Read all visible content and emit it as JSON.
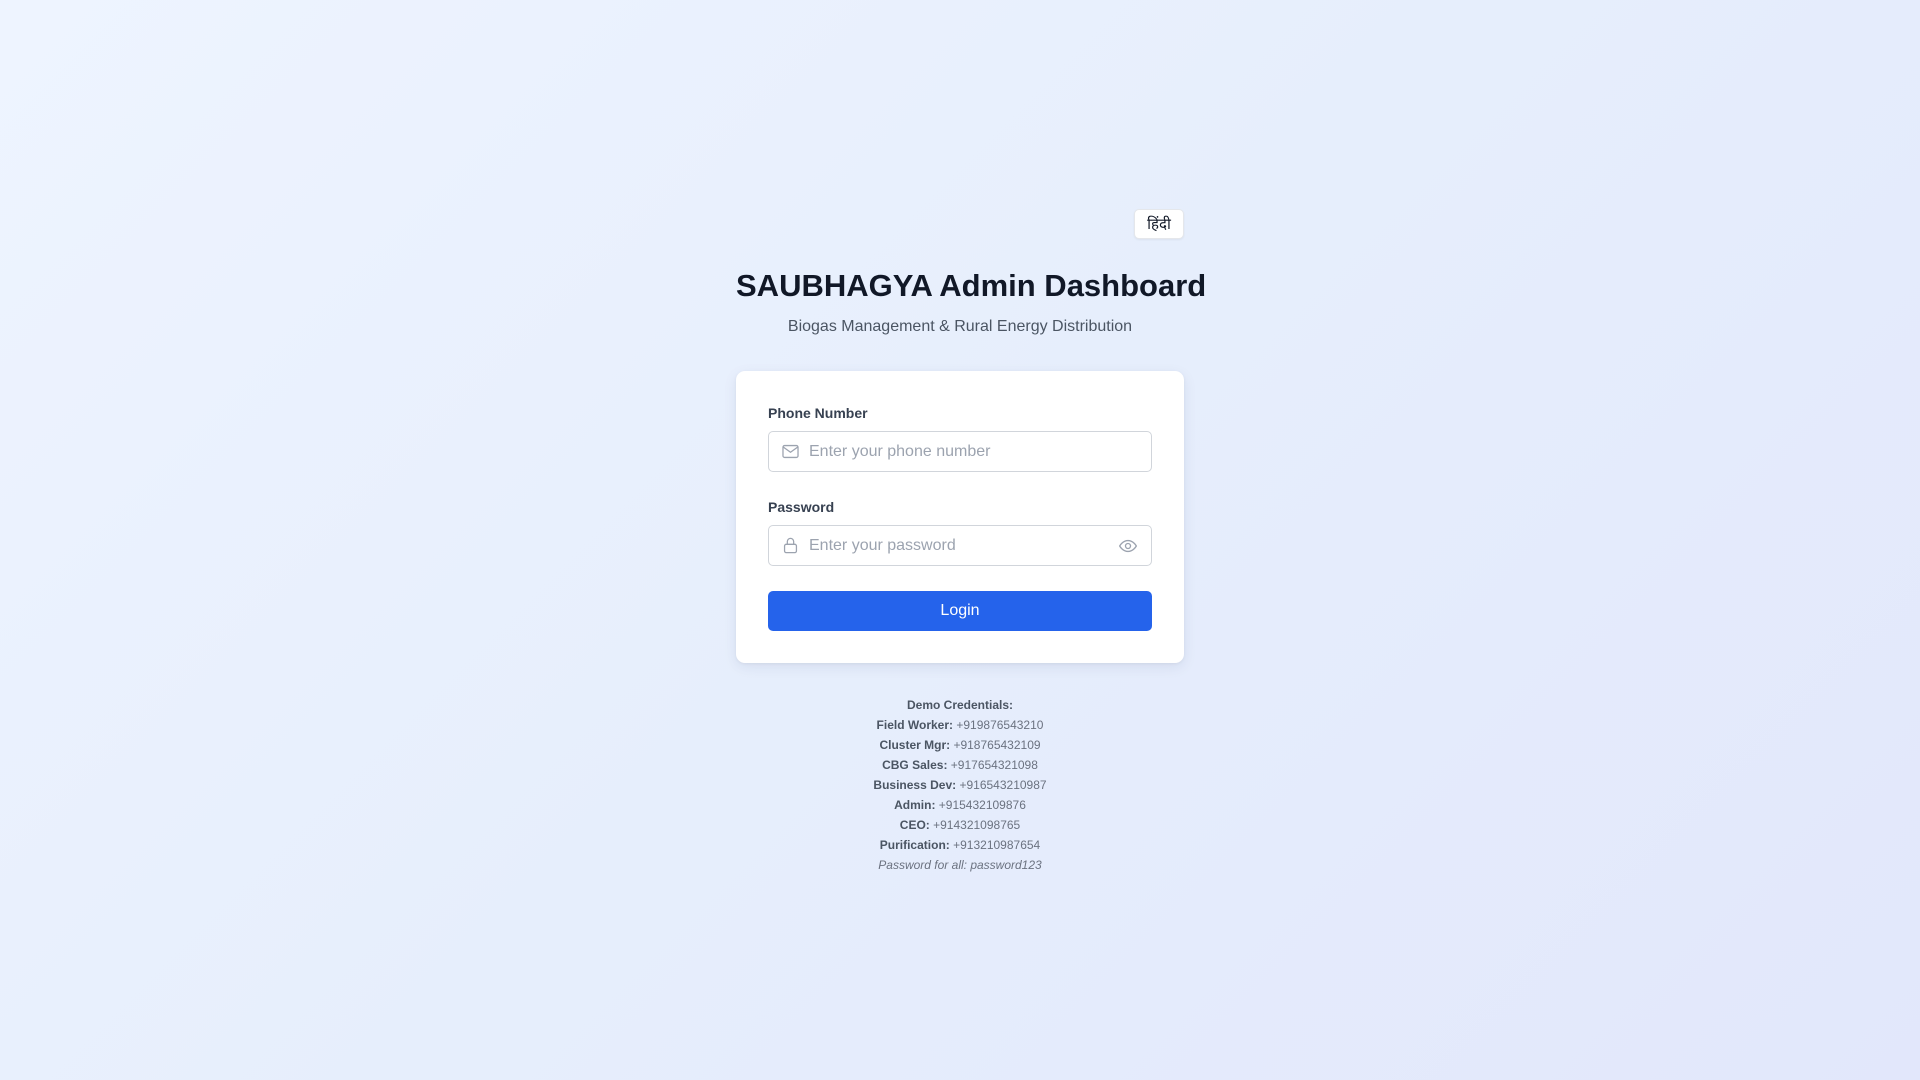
{
  "language_toggle": {
    "label": "हिंदी"
  },
  "header": {
    "title": "SAUBHAGYA Admin Dashboard",
    "subtitle": "Biogas Management & Rural Energy Distribution"
  },
  "form": {
    "phone": {
      "label": "Phone Number",
      "placeholder": "Enter your phone number",
      "value": "",
      "icon": "mail-icon"
    },
    "password": {
      "label": "Password",
      "placeholder": "Enter your password",
      "value": "",
      "icon": "lock-icon",
      "toggle_icon": "eye-icon"
    },
    "submit_label": "Login"
  },
  "demo": {
    "heading": "Demo Credentials:",
    "entries": [
      {
        "role": "Field Worker:",
        "phone": "+919876543210"
      },
      {
        "role": "Cluster Mgr:",
        "phone": "+918765432109"
      },
      {
        "role": "CBG Sales:",
        "phone": "+917654321098"
      },
      {
        "role": "Business Dev:",
        "phone": "+916543210987"
      },
      {
        "role": "Admin:",
        "phone": "+915432109876"
      },
      {
        "role": "CEO:",
        "phone": "+914321098765"
      },
      {
        "role": "Purification:",
        "phone": "+913210987654"
      }
    ],
    "note": "Password for all: password123"
  },
  "colors": {
    "primary": "#2563eb",
    "title": "#111827",
    "muted": "#6b7280",
    "background": "#e8eefc"
  }
}
